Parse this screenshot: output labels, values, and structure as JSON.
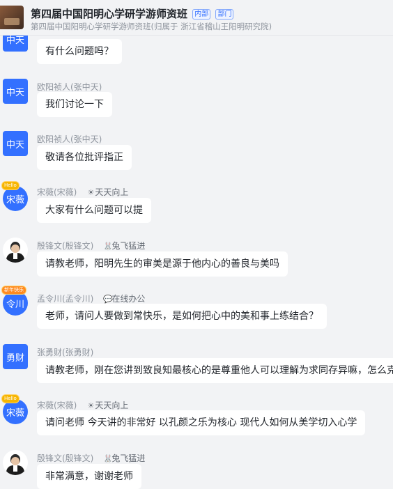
{
  "header": {
    "title": "第四届中国阳明心学研学游师资班",
    "tag_internal": "内部",
    "tag_department": "部门",
    "subtitle": "第四届中国阳明心学研学游师资班(归属于 浙江省稽山王阳明研究院)"
  },
  "messages": [
    {
      "avatar_text": "中天",
      "bubble": "有什么问题吗？"
    },
    {
      "avatar_text": "中天",
      "name": "欧阳祯人(张中天)",
      "bubble": "我们讨论一下"
    },
    {
      "avatar_text": "中天",
      "name": "欧阳祯人(张中天)",
      "bubble": "敬请各位批评指正"
    },
    {
      "avatar_text": "宋薇",
      "avatar_badge": "Hello",
      "name": "宋薇(宋薇)",
      "status_icon": "sun-icon",
      "status": "天天向上",
      "bubble": "大家有什么问题可以提"
    },
    {
      "name": "殷锋文(殷锋文)",
      "status_icon": "rabbit-icon",
      "status": "兔飞猛进",
      "bubble": "请教老师，阳明先生的审美是源于他内心的善良与美吗"
    },
    {
      "avatar_text": "令川",
      "avatar_badge": "新年快乐",
      "name": "孟令川(孟令川)",
      "status_icon": "chat-icon",
      "status": "在线办公",
      "bubble": "老师，请问人要做到常快乐，是如何把心中的美和事上练结合？"
    },
    {
      "avatar_text": "勇财",
      "name": "张勇财(张勇财)",
      "bubble": "请教老师，刚在您讲到致良知最核心的是尊重他人可以理解为求同存异嘛，怎么克"
    },
    {
      "avatar_text": "宋薇",
      "avatar_badge": "Hello",
      "name": "宋薇(宋薇)",
      "status_icon": "sun-icon",
      "status": "天天向上",
      "bubble": "请问老师 今天讲的非常好 以孔颜之乐为核心 现代人如何从美学切入心学"
    },
    {
      "name": "殷锋文(殷锋文)",
      "status_icon": "rabbit-icon",
      "status": "兔飞猛进",
      "bubble": "非常满意，谢谢老师"
    }
  ]
}
